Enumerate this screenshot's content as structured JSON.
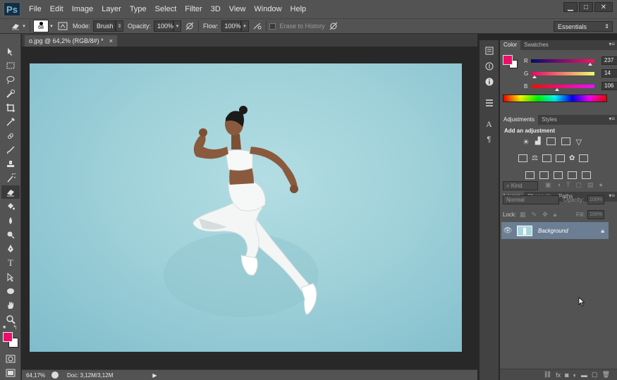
{
  "app": {
    "logo": "Ps"
  },
  "menu": [
    "File",
    "Edit",
    "Image",
    "Layer",
    "Type",
    "Select",
    "Filter",
    "3D",
    "View",
    "Window",
    "Help"
  ],
  "window_controls": [
    "▁",
    "□",
    "✕"
  ],
  "options": {
    "brush_size": "68",
    "mode_label": "Mode:",
    "mode_value": "Brush",
    "opacity_label": "Opacity:",
    "opacity_value": "100%",
    "flow_label": "Flow:",
    "flow_value": "100%",
    "erase_history_label": "Erase to History",
    "workspace": "Essentials"
  },
  "document": {
    "tab_title": "o.jpg @ 64,2% (RGB/8#) *",
    "tab_close": "×",
    "zoom": "64,17%",
    "doc_info": "Doc: 3,12M/3,12M"
  },
  "colors": {
    "foreground": "#ed0e6a",
    "background": "#ffffff",
    "canvas_bg": "#a7d5dc"
  },
  "color_panel": {
    "tabs": [
      "Color",
      "Swatches"
    ],
    "channels": [
      {
        "label": "R",
        "value": "237",
        "fraction": 0.929
      },
      {
        "label": "G",
        "value": "14",
        "fraction": 0.055
      },
      {
        "label": "B",
        "value": "106",
        "fraction": 0.416
      }
    ]
  },
  "adjustments_panel": {
    "tabs": [
      "Adjustments",
      "Styles"
    ],
    "heading": "Add an adjustment"
  },
  "layers_panel": {
    "tabs": [
      "Layers",
      "Channels",
      "Paths"
    ],
    "filter_kind": "Kind",
    "blend_mode": "Normal",
    "opacity_label": "Opacity:",
    "opacity_value": "100%",
    "lock_label": "Lock:",
    "fill_label": "Fill:",
    "fill_value": "100%",
    "layers": [
      {
        "name": "Background",
        "visible": true,
        "locked": true
      }
    ],
    "bottom_icons": [
      "link-icon",
      "fx-icon",
      "mask-icon",
      "adjustment-icon",
      "folder-icon",
      "new-layer-icon",
      "trash-icon"
    ]
  }
}
